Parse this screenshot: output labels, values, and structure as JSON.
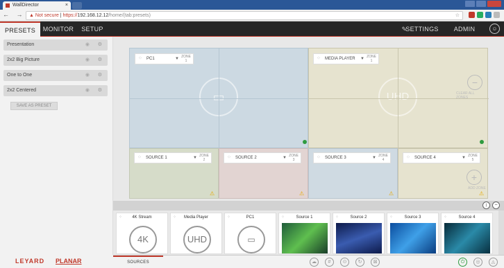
{
  "browser": {
    "tab_title": "WallDirector",
    "tab_close": "×",
    "nav_glyphs": "← → C",
    "warning": "▲ Not secure",
    "url_scheme": "https://",
    "url_host": "192.168.12.12",
    "url_path": "/home/(tab:presets)",
    "star": "☆"
  },
  "appbar": {
    "tabs": [
      "PRESETS",
      "MONITOR",
      "SETUP"
    ],
    "settings": "SETTINGS",
    "admin": "ADMIN"
  },
  "presets": [
    "Presentation",
    "2x2 Big Picture",
    "One to One",
    "2x2 Centered"
  ],
  "save_preset": "SAVE AS PRESET",
  "logo": {
    "leyard": "LEYARD",
    "planar": "PLANAR"
  },
  "zones": [
    {
      "name": "PC1",
      "zone": "ZONE",
      "num": "1"
    },
    {
      "name": "MEDIA PLAYER",
      "zone": "ZONE",
      "num": "1"
    },
    {
      "name": "SOURCE 1",
      "zone": "ZONE",
      "num": "2"
    },
    {
      "name": "SOURCE 2",
      "zone": "ZONE",
      "num": "3"
    },
    {
      "name": "SOURCE 3",
      "zone": "ZONE",
      "num": "4"
    },
    {
      "name": "SOURCE 4",
      "zone": "ZONE",
      "num": "5"
    }
  ],
  "center_labels": {
    "uhd": "UHD"
  },
  "side_labels": {
    "clear": "CLEAR ALL ZONES",
    "add": "ADD ZONE"
  },
  "sources": [
    {
      "name": "4K Stream",
      "icon": "4K"
    },
    {
      "name": "Media Player",
      "icon": "UHD"
    },
    {
      "name": "PC1",
      "icon": "PC"
    },
    {
      "name": "Source 1",
      "color": "#2a7d4f"
    },
    {
      "name": "Source 2",
      "color": "#1a2d6b"
    },
    {
      "name": "Source 3",
      "color": "#1c6fbf"
    },
    {
      "name": "Source 4",
      "color": "#0d3b4d"
    }
  ],
  "bottom": {
    "sources_tab": "SOURCES"
  },
  "colors": {
    "accent": "#c0392b",
    "green": "#2e9b3f"
  }
}
